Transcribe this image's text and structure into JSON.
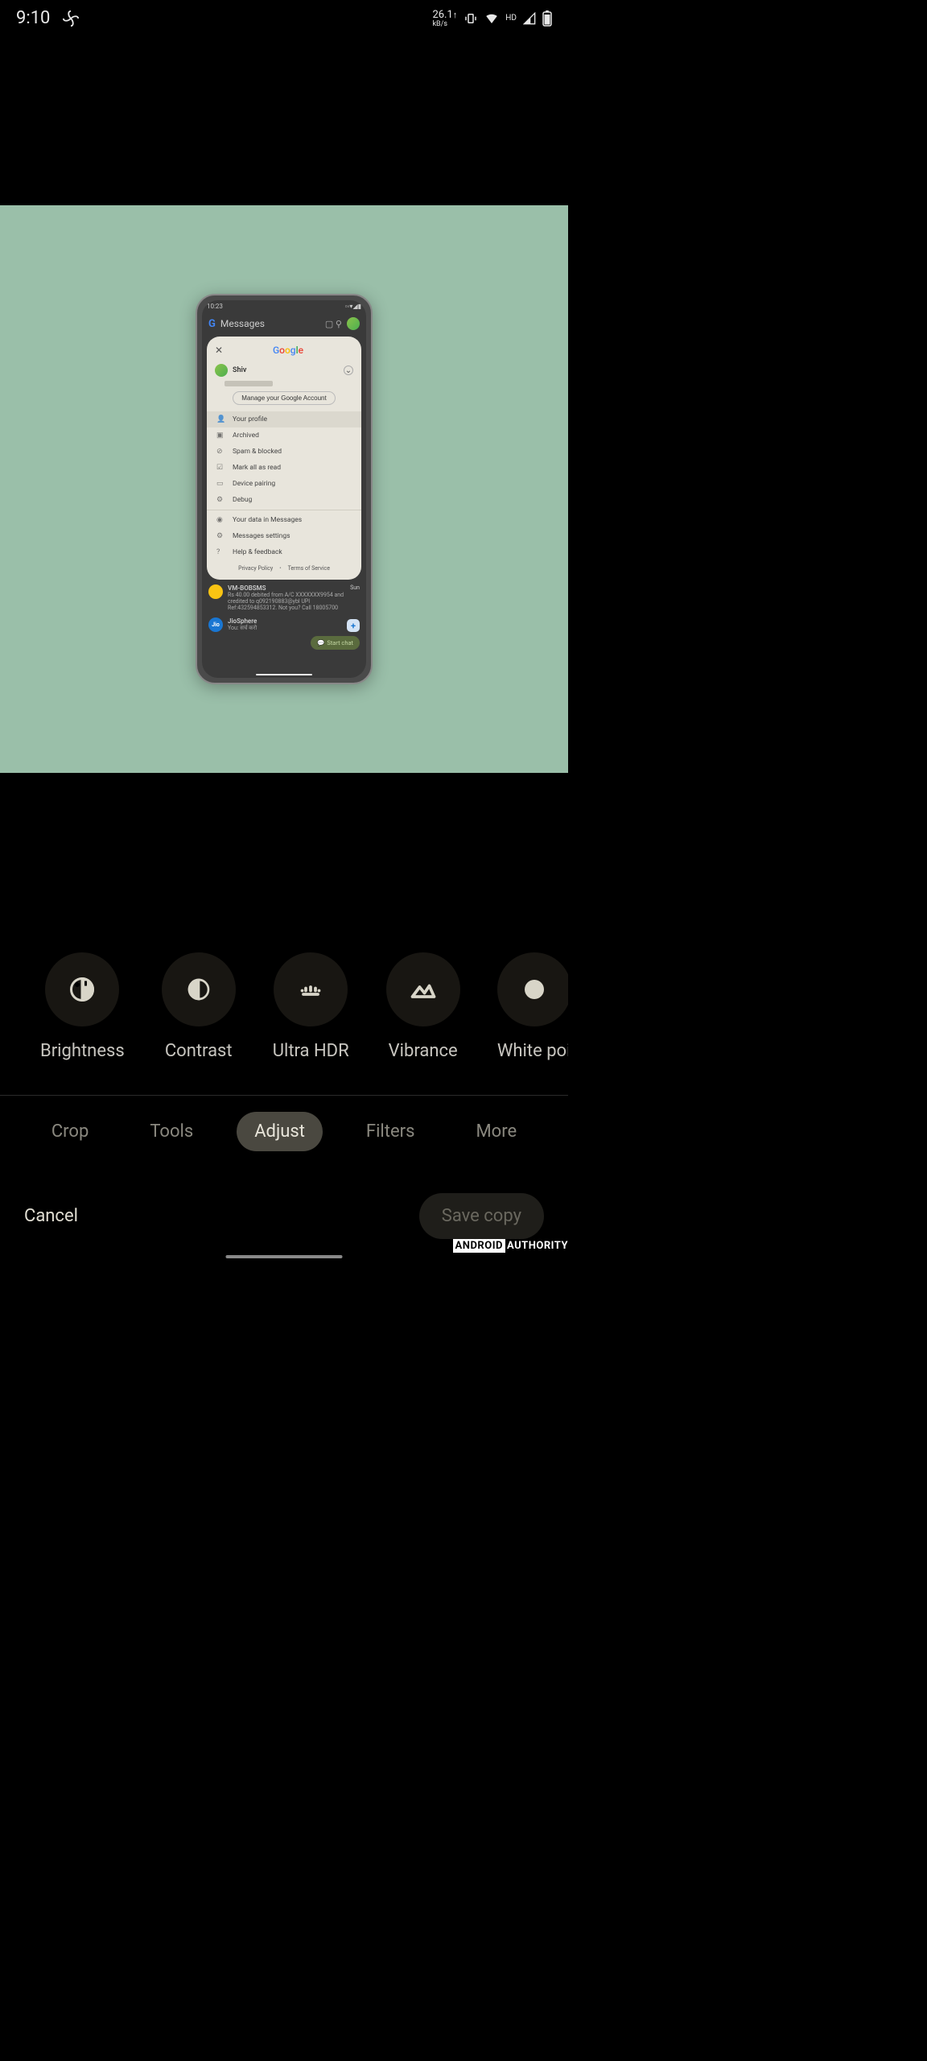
{
  "status": {
    "time": "9:10",
    "speed_value": "26.1",
    "speed_unit": "kB/s",
    "signal_label": "HD"
  },
  "inner_phone": {
    "status_time": "10:23",
    "app_title": "Messages",
    "popup_brand": "Google",
    "account_name": "Shiv",
    "manage_account": "Manage your Google Account",
    "menu": [
      "Your profile",
      "Archived",
      "Spam & blocked",
      "Mark all as read",
      "Device pairing",
      "Debug",
      "Your data in Messages",
      "Messages settings",
      "Help & feedback"
    ],
    "privacy": "Privacy Policy",
    "terms": "Terms of Service",
    "conv1_title": "VM-BOBSMS",
    "conv1_day": "Sun",
    "conv1_body": "Rs 40.00 debited from A/C XXXXXXX9954 and credited to q092190883@ybl UPI Ref:432594853312. Not you? Call 18005700",
    "conv2_title": "JioSphere",
    "conv2_body": "You: सर्च करो",
    "fab_label": "Start chat"
  },
  "adjustments": [
    {
      "label": "Brightness",
      "icon": "brightness"
    },
    {
      "label": "Contrast",
      "icon": "contrast"
    },
    {
      "label": "Ultra HDR",
      "icon": "hdr"
    },
    {
      "label": "Vibrance",
      "icon": "vibrance"
    },
    {
      "label": "White poi",
      "icon": "whitepoint"
    }
  ],
  "tabs": [
    {
      "label": "Crop",
      "active": false
    },
    {
      "label": "Tools",
      "active": false
    },
    {
      "label": "Adjust",
      "active": true
    },
    {
      "label": "Filters",
      "active": false
    },
    {
      "label": "More",
      "active": false
    }
  ],
  "actions": {
    "cancel": "Cancel",
    "save": "Save copy"
  },
  "watermark": {
    "box": "ANDROID",
    "text": "AUTHORITY"
  }
}
